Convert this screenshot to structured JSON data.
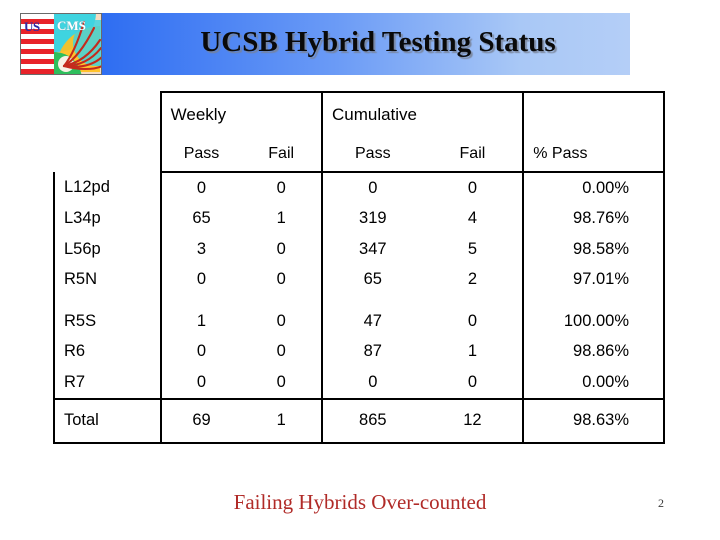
{
  "slide": {
    "title": "UCSB Hybrid Testing Status",
    "logo": {
      "us_text": "US",
      "cms_text": "CMS",
      "alt": "us-cms-logo"
    },
    "footer_note": "Failing Hybrids Over-counted",
    "page_number": "2",
    "colors": {
      "banner_gradient_start": "#0f55ef",
      "banner_gradient_end": "#b4cef7",
      "title_text": "#0a0a0a",
      "footer_note": "#b02a27",
      "table_border": "#000000",
      "flag_red": "#e8232a",
      "cms_cyan": "#3fd4e0",
      "cms_orange": "#ffc020",
      "cms_track_red": "#c42a1c"
    }
  },
  "table": {
    "group_headers": {
      "label": "",
      "weekly": "Weekly",
      "cumulative": "Cumulative",
      "percent": ""
    },
    "sub_headers": {
      "label": "",
      "weekly_pass": "Pass",
      "weekly_fail": "Fail",
      "cumulative_pass": "Pass",
      "cumulative_fail": "Fail",
      "percent_pass": "% Pass"
    },
    "group_one": [
      {
        "label": "L12pd",
        "weekly_pass": "0",
        "weekly_fail": "0",
        "cumulative_pass": "0",
        "cumulative_fail": "0",
        "percent_pass": "0.00%"
      },
      {
        "label": "L34p",
        "weekly_pass": "65",
        "weekly_fail": "1",
        "cumulative_pass": "319",
        "cumulative_fail": "4",
        "percent_pass": "98.76%"
      },
      {
        "label": "L56p",
        "weekly_pass": "3",
        "weekly_fail": "0",
        "cumulative_pass": "347",
        "cumulative_fail": "5",
        "percent_pass": "98.58%"
      },
      {
        "label": "R5N",
        "weekly_pass": "0",
        "weekly_fail": "0",
        "cumulative_pass": "65",
        "cumulative_fail": "2",
        "percent_pass": "97.01%"
      }
    ],
    "group_two": [
      {
        "label": "R5S",
        "weekly_pass": "1",
        "weekly_fail": "0",
        "cumulative_pass": "47",
        "cumulative_fail": "0",
        "percent_pass": "100.00%"
      },
      {
        "label": "R6",
        "weekly_pass": "0",
        "weekly_fail": "0",
        "cumulative_pass": "87",
        "cumulative_fail": "1",
        "percent_pass": "98.86%"
      },
      {
        "label": "R7",
        "weekly_pass": "0",
        "weekly_fail": "0",
        "cumulative_pass": "0",
        "cumulative_fail": "0",
        "percent_pass": "0.00%"
      }
    ],
    "total": {
      "label": "Total",
      "weekly_pass": "69",
      "weekly_fail": "1",
      "cumulative_pass": "865",
      "cumulative_fail": "12",
      "percent_pass": "98.63%"
    }
  }
}
